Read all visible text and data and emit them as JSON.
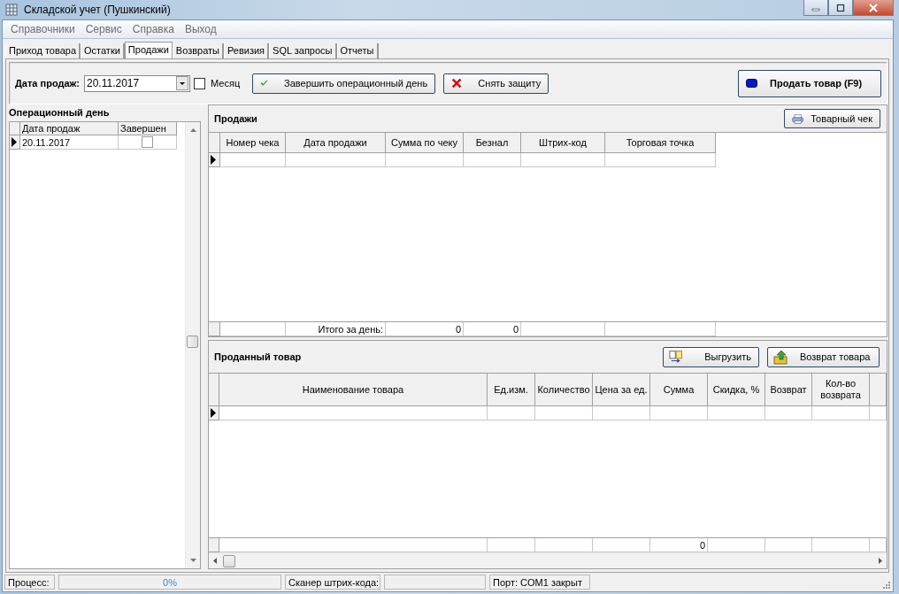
{
  "window": {
    "title": "Складской учет (Пушкинский)"
  },
  "menu": [
    "Справочники",
    "Сервис",
    "Справка",
    "Выход"
  ],
  "tabs": [
    {
      "label": "Приход товара",
      "selected": false
    },
    {
      "label": "Остатки",
      "selected": false
    },
    {
      "label": "Продажи",
      "selected": true
    },
    {
      "label": "Возвраты",
      "selected": false
    },
    {
      "label": "Ревизия",
      "selected": false
    },
    {
      "label": "SQL запросы",
      "selected": false
    },
    {
      "label": "Отчеты",
      "selected": false
    }
  ],
  "toolbar": {
    "date_label": "Дата продаж:",
    "date_value": "20.11.2017",
    "month_checkbox": {
      "label": "Месяц",
      "checked": false
    },
    "finish_day_button": "Завершить операционный день",
    "remove_protection_button": "Снять защиту",
    "sell_button": "Продать товар (F9)"
  },
  "operational_day": {
    "title": "Операционный день",
    "columns": [
      "Дата продаж",
      "Завершен"
    ],
    "rows": [
      {
        "date": "20.11.2017",
        "completed": false,
        "current": true
      }
    ]
  },
  "sales": {
    "title": "Продажи",
    "receipt_button": "Товарный чек",
    "columns": [
      "Номер чека",
      "Дата продажи",
      "Сумма по чеку",
      "Безнал",
      "Штрих-код",
      "Торговая точка"
    ],
    "rows": [
      {
        "current": true
      }
    ],
    "totals": {
      "label": "Итого за день:",
      "sum": "0",
      "cashless": "0"
    }
  },
  "sold_goods": {
    "title": "Проданный товар",
    "export_button": "Выгрузить",
    "return_button": "Возврат товара",
    "columns": [
      "Наименование товара",
      "Ед.изм.",
      "Количество",
      "Цена за ед.",
      "Сумма",
      "Скидка, %",
      "Возврат",
      "Кол-во возврата"
    ],
    "rows": [
      {
        "current": true
      }
    ],
    "totals": {
      "sum": "0"
    }
  },
  "status_bar": {
    "process_label": "Процесс:",
    "progress": {
      "level": 0,
      "reading": "0%"
    },
    "scanner_label": "Сканер штрих-кода:",
    "port": "Порт: COM1 закрыт"
  }
}
